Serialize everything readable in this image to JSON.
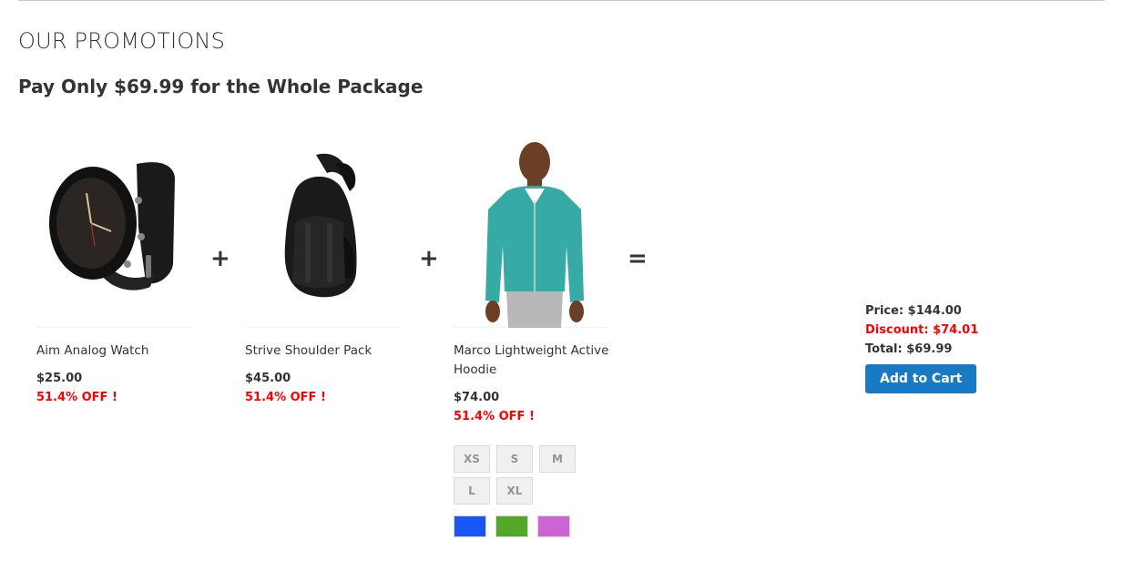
{
  "section_title": "OUR PROMOTIONS",
  "promo_heading": "Pay Only $69.99 for the Whole Package",
  "operators": {
    "plus": "+",
    "equals": "="
  },
  "products": [
    {
      "name": "Aim Analog Watch",
      "price": "$25.00",
      "discount_label": "51.4% OFF !",
      "image": "watch-image"
    },
    {
      "name": "Strive Shoulder Pack",
      "price": "$45.00",
      "discount_label": "51.4% OFF !",
      "image": "backpack-image"
    },
    {
      "name": "Marco Lightweight Active Hoodie",
      "price": "$74.00",
      "discount_label": "51.4% OFF !",
      "image": "hoodie-image",
      "sizes": [
        "XS",
        "S",
        "M",
        "L",
        "XL"
      ],
      "colors": [
        {
          "name": "Blue",
          "hex": "#1857f7"
        },
        {
          "name": "Green",
          "hex": "#53a828"
        },
        {
          "name": "Purple",
          "hex": "#ce64d4"
        }
      ]
    }
  ],
  "summary": {
    "price": "Price: $144.00",
    "discount": "Discount: $74.01",
    "total": "Total: $69.99",
    "add_to_cart_label": "Add to Cart"
  },
  "colors": {
    "accent": "#1979c3",
    "discount": "#ff0000",
    "text": "#333333"
  }
}
